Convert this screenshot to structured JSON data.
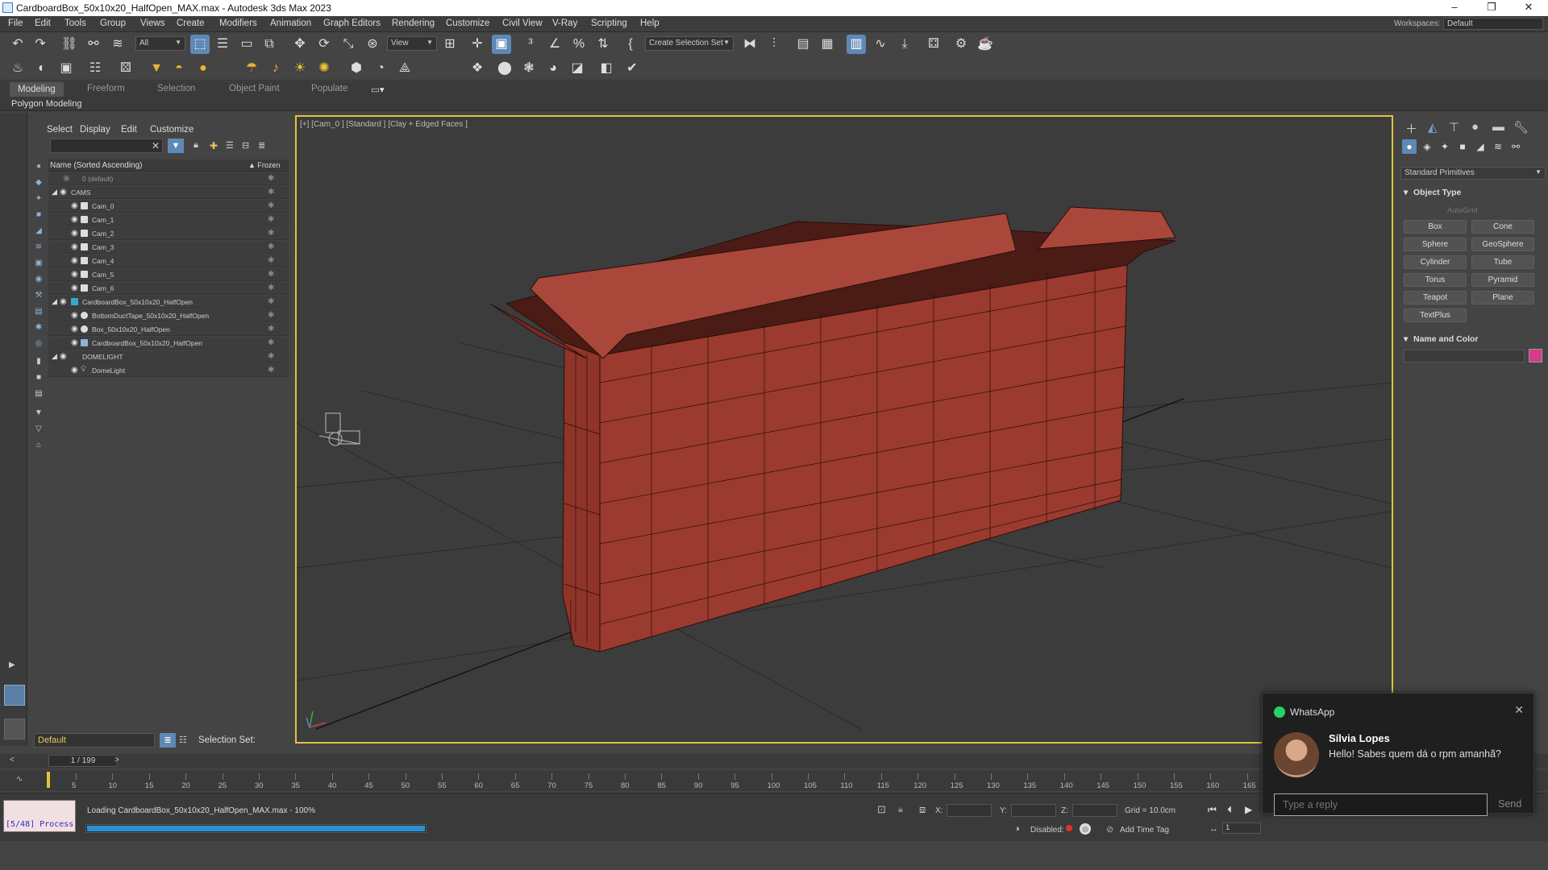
{
  "window": {
    "title": "CardboardBox_50x10x20_HalfOpen_MAX.max - Autodesk 3ds Max 2023",
    "minimize": "–",
    "maximize": "❐",
    "close": "✕"
  },
  "menu": [
    "File",
    "Edit",
    "Tools",
    "Group",
    "Views",
    "Create",
    "Modifiers",
    "Animation",
    "Graph Editors",
    "Rendering",
    "Customize",
    "Civil View",
    "V-Ray",
    "Scripting",
    "Help"
  ],
  "workspaces": {
    "label": "Workspaces:",
    "value": "Default"
  },
  "toolbar": {
    "selection_filter": "All",
    "ref_coord": "View",
    "named_selection": "Create Selection Set"
  },
  "ribbon": {
    "tabs": [
      "Modeling",
      "Freeform",
      "Selection",
      "Object Paint",
      "Populate"
    ],
    "sub": "Polygon Modeling"
  },
  "scene_explorer": {
    "menus": [
      "Select",
      "Display",
      "Edit",
      "Customize"
    ],
    "header_name": "Name (Sorted Ascending)",
    "header_frozen": "▲ Frozen",
    "rows": [
      {
        "label": "0 (default)",
        "indent": 0
      },
      {
        "label": "CAMS",
        "indent": 0
      },
      {
        "label": "Cam_0",
        "indent": 1
      },
      {
        "label": "Cam_1",
        "indent": 1
      },
      {
        "label": "Cam_2",
        "indent": 1
      },
      {
        "label": "Cam_3",
        "indent": 1
      },
      {
        "label": "Cam_4",
        "indent": 1
      },
      {
        "label": "Cam_5",
        "indent": 1
      },
      {
        "label": "Cam_6",
        "indent": 1
      },
      {
        "label": "CardboardBox_50x10x20_HalfOpen",
        "indent": 0
      },
      {
        "label": "BottomDuctTape_50x10x20_HalfOpen",
        "indent": 1
      },
      {
        "label": "Box_50x10x20_HalfOpen",
        "indent": 1
      },
      {
        "label": "CardboardBox_50x10x20_HalfOpen",
        "indent": 1
      },
      {
        "label": "DOMELIGHT",
        "indent": 0
      },
      {
        "label": "DomeLight",
        "indent": 1
      }
    ],
    "layer": "Default",
    "selection_set_label": "Selection Set:"
  },
  "viewport": {
    "label": "[+] [Cam_0 ] [Standard ] [Clay + Edged Faces ]",
    "box_color": "#9b3a2e"
  },
  "command_panel": {
    "dropdown": "Standard Primitives",
    "object_type": "Object Type",
    "autogrid": "AutoGrid",
    "buttons": [
      "Box",
      "Cone",
      "Sphere",
      "GeoSphere",
      "Cylinder",
      "Tube",
      "Torus",
      "Pyramid",
      "Teapot",
      "Plane",
      "TextPlus"
    ],
    "name_color": "Name and Color",
    "swatch": "#d63a8a"
  },
  "timeline": {
    "frame": "1 / 199",
    "ticks": [
      "5",
      "10",
      "15",
      "20",
      "25",
      "30",
      "35",
      "40",
      "45",
      "50",
      "55",
      "60",
      "65",
      "70",
      "75",
      "80",
      "85",
      "90",
      "95",
      "100",
      "105",
      "110",
      "115",
      "120",
      "125",
      "130",
      "135",
      "140",
      "145",
      "150",
      "155",
      "160",
      "165"
    ]
  },
  "status": {
    "maxscript": "[5/48] Process",
    "prompt": "Loading CardboardBox_50x10x20_HalfOpen_MAX.max  -  100%",
    "progress": 1.0,
    "x_label": "X:",
    "y_label": "Y:",
    "z_label": "Z:",
    "grid": "Grid = 10.0cm",
    "disabled": "Disabled:",
    "add_time_tag": "Add Time Tag",
    "frame_field": "1"
  },
  "notification": {
    "app": "WhatsApp",
    "sender": "Sílvia Lopes",
    "message": "Hello! Sabes quem dá o rpm amanhã?",
    "reply_placeholder": "Type a reply",
    "send": "Send"
  }
}
